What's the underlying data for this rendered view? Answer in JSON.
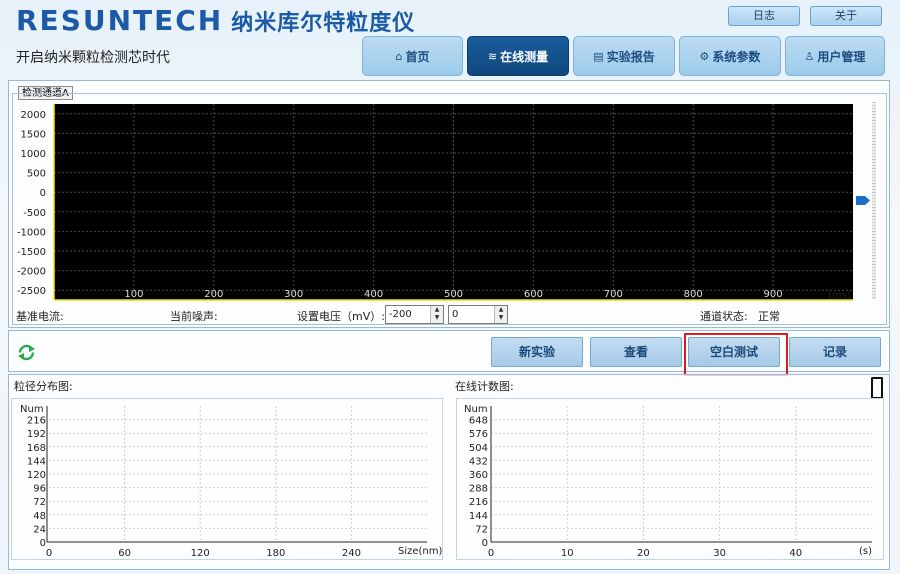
{
  "header": {
    "logo_en": "RESUNTECH",
    "logo_zh": "纳米库尔特粒度仪",
    "slogan": "开启纳米颗粒检测芯时代",
    "log_label": "日志",
    "about_label": "关于"
  },
  "nav": {
    "tabs": [
      {
        "label": "首页",
        "icon": "home-icon",
        "active": false
      },
      {
        "label": "在线测量",
        "icon": "measure-icon",
        "active": true
      },
      {
        "label": "实验报告",
        "icon": "report-icon",
        "active": false
      },
      {
        "label": "系统参数",
        "icon": "gear-icon",
        "active": false
      },
      {
        "label": "用户管理",
        "icon": "user-icon",
        "active": false
      }
    ]
  },
  "channel": {
    "tab_label": "检测通道A",
    "baseline_label": "基准电流:",
    "noise_label": "当前噪声:",
    "voltage_label": "设置电压（mV）:",
    "voltage_value": "-200",
    "second_value": "0",
    "status_label": "通道状态:",
    "status_value": "正常"
  },
  "actions": {
    "new_label": "新实验",
    "view_label": "查看",
    "blank_label": "空白测试",
    "record_label": "记录"
  },
  "sections": {
    "size_title": "粒径分布图:",
    "count_title": "在线计数图:",
    "counter_value": "0"
  },
  "colors": {
    "accent": "#1c5aa6",
    "active_tab": "#155590",
    "highlight": "#d21f1f",
    "signal_axis": "#f2e600",
    "refresh": "#2ea84a"
  },
  "chart_data": [
    {
      "type": "line",
      "x_ticks": [
        100,
        200,
        300,
        400,
        500,
        600,
        700,
        800,
        900
      ],
      "y_ticks": [
        2000,
        1500,
        1000,
        500,
        0,
        -500,
        -1000,
        -1500,
        -2000,
        -2500
      ],
      "x_unit": "(ms)",
      "xlim": [
        0,
        1000
      ],
      "ylim": [
        -2750,
        2250
      ],
      "series": [],
      "grid": true
    },
    {
      "type": "bar",
      "ylabel": "Num",
      "xlabel": "Size(nm)",
      "x_ticks": [
        0,
        60,
        120,
        180,
        240
      ],
      "y_ticks": [
        0,
        24,
        48,
        72,
        96,
        120,
        144,
        168,
        192,
        216
      ],
      "xlim": [
        0,
        300
      ],
      "ylim": [
        0,
        240
      ],
      "series": [],
      "grid": true
    },
    {
      "type": "line",
      "ylabel": "Num",
      "xlabel": "(s)",
      "x_ticks": [
        0,
        10,
        20,
        30,
        40
      ],
      "y_ticks": [
        0,
        72,
        144,
        216,
        288,
        360,
        432,
        504,
        576,
        648
      ],
      "xlim": [
        0,
        50
      ],
      "ylim": [
        0,
        720
      ],
      "series": [],
      "grid": true
    }
  ]
}
